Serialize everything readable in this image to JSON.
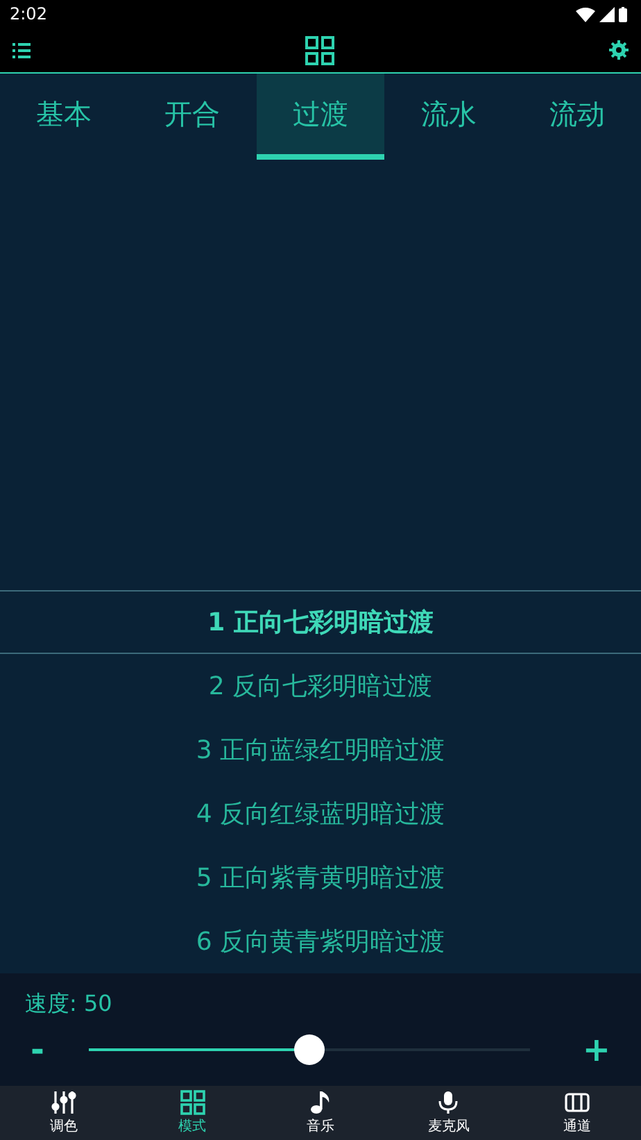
{
  "status_bar": {
    "time": "2:02"
  },
  "tabs": [
    {
      "label": "基本",
      "selected": false
    },
    {
      "label": "开合",
      "selected": false
    },
    {
      "label": "过渡",
      "selected": true
    },
    {
      "label": "流水",
      "selected": false
    },
    {
      "label": "流动",
      "selected": false
    }
  ],
  "modes": [
    {
      "label": "1 正向七彩明暗过渡",
      "selected": true
    },
    {
      "label": "2 反向七彩明暗过渡",
      "selected": false
    },
    {
      "label": "3 正向蓝绿红明暗过渡",
      "selected": false
    },
    {
      "label": "4 反向红绿蓝明暗过渡",
      "selected": false
    },
    {
      "label": "5 正向紫青黄明暗过渡",
      "selected": false
    },
    {
      "label": "6 反向黄青紫明暗过渡",
      "selected": false
    }
  ],
  "speed": {
    "label": "速度: 50",
    "level": 0.5,
    "minus": "-",
    "plus": "+"
  },
  "nav": [
    {
      "label": "调色",
      "kind": "sliders",
      "selected": false
    },
    {
      "label": "模式",
      "kind": "grid",
      "selected": true
    },
    {
      "label": "音乐",
      "kind": "note",
      "selected": false
    },
    {
      "label": "麦克风",
      "kind": "mic",
      "selected": false
    },
    {
      "label": "通道",
      "kind": "channel",
      "selected": false
    }
  ]
}
